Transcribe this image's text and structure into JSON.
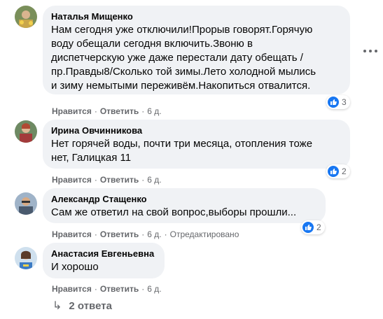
{
  "comments": [
    {
      "name": "Наталья Мищенко",
      "lines": [
        "Нам сегодня уже отключили!Прорыв говорят.Горячую",
        "воду обещали сегодня включить.Звоню в",
        "диспетчерскую уже даже перестали дату обещать /",
        "пр.Правды8/Сколько той зимы.Лето холодной мылись",
        "и зиму немытыми переживём.Накопиться отвалится."
      ],
      "like_label": "Нравится",
      "reply_label": "Ответить",
      "time": "6 д.",
      "reactions": "3"
    },
    {
      "name": "Ирина Овчинникова",
      "lines": [
        "Нет горячей воды, почти три месяца, отопления тоже",
        "нет, Галицкая 11"
      ],
      "like_label": "Нравится",
      "reply_label": "Ответить",
      "time": "6 д.",
      "reactions": "2"
    },
    {
      "name": "Александр Стащенко",
      "lines": [
        "Сам же ответил на свой вопрос,выборы прошли..."
      ],
      "like_label": "Нравится",
      "reply_label": "Ответить",
      "time": "6 д.",
      "edited": "Отредактировано",
      "reactions": "2"
    },
    {
      "name": "Анастасия Евгеньевна",
      "lines": [
        "И хорошо"
      ],
      "like_label": "Нравится",
      "reply_label": "Ответить",
      "time": "6 д."
    }
  ],
  "replies_label": "2 ответа",
  "colors": {
    "bubble": "#f0f2f5",
    "like_blue": "#1877f2",
    "meta_gray": "#65676b"
  }
}
